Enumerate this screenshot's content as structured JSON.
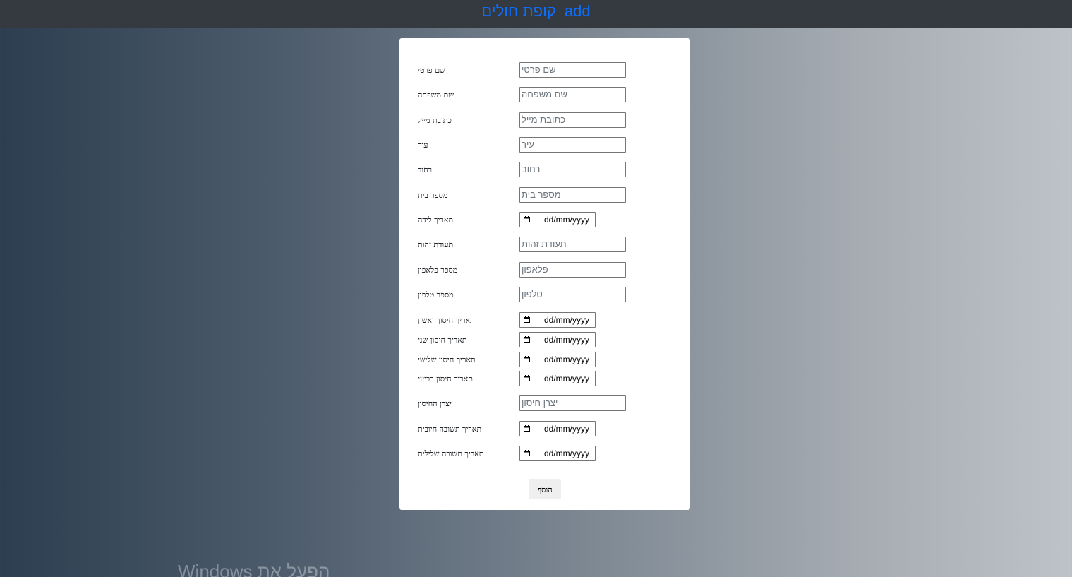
{
  "navbar": {
    "brand_hebrew": "קופת חולים",
    "brand_link": "add"
  },
  "form": {
    "first_name": {
      "label": "שם פרטי",
      "placeholder": "שם פרטי"
    },
    "last_name": {
      "label": "שם משפחה",
      "placeholder": "שם משפחה"
    },
    "email": {
      "label": "כתובת מייל",
      "placeholder": "כתובת מייל"
    },
    "city": {
      "label": "עיר",
      "placeholder": "עיר"
    },
    "street": {
      "label": "רחוב",
      "placeholder": "רחוב"
    },
    "house_number": {
      "label": "מספר בית",
      "placeholder": "מספר בית"
    },
    "birth_date": {
      "label": "תאריך לידה",
      "value": "dd/mm/yyyy"
    },
    "id_number": {
      "label": "תעודת זהות",
      "placeholder": "תעודת זהות"
    },
    "mobile": {
      "label": "מספר פלאפון",
      "placeholder": "פלאפון"
    },
    "phone": {
      "label": "מספר טלפון",
      "placeholder": "טלפון"
    },
    "vaccine_1": {
      "label": "תאריך חיסון ראשון",
      "value": "dd/mm/yyyy"
    },
    "vaccine_2": {
      "label": "תאריך חיסון שני",
      "value": "dd/mm/yyyy"
    },
    "vaccine_3": {
      "label": "תאריך חיסון שלישי",
      "value": "dd/mm/yyyy"
    },
    "vaccine_4": {
      "label": "תאריך חיסון רביעי",
      "value": "dd/mm/yyyy"
    },
    "manufacturer": {
      "label": "יצרן החיסון",
      "placeholder": "יצרן חיסון"
    },
    "positive_date": {
      "label": "תאריך תשובה חיובית",
      "value": "dd/mm/yyyy"
    },
    "negative_date": {
      "label": "תאריך תשובה שלילית",
      "value": "dd/mm/yyyy"
    },
    "submit_label": "הוסף"
  },
  "overlay": {
    "watermark": "הפעל את Windows"
  },
  "icons": {
    "date_picker": "calendar-icon"
  }
}
